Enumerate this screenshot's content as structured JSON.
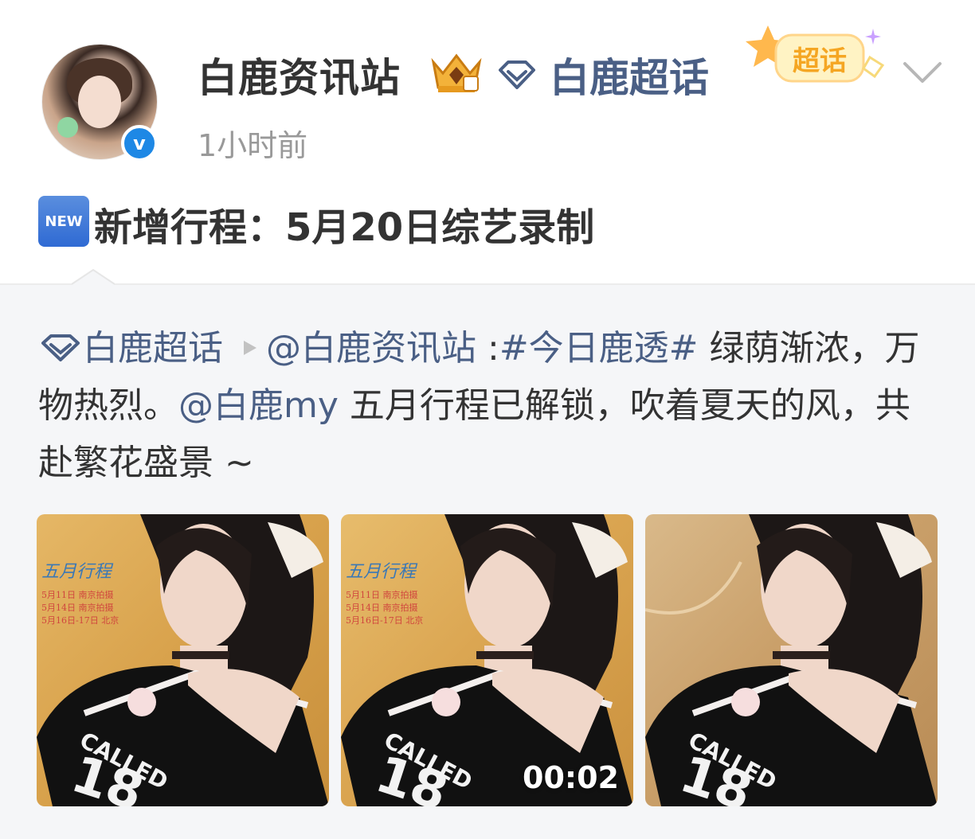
{
  "header": {
    "username": "白鹿资讯站",
    "topic_label": "白鹿超话",
    "supertopic_badge_label": "超话",
    "timestamp": "1小时前"
  },
  "post": {
    "new_badge_label": "NEW",
    "title": "新增行程：5月20日综艺录制"
  },
  "repost": {
    "topic_label": "白鹿超话",
    "mention_author": "@白鹿资讯站",
    "separator": " :",
    "hashtag": "#今日鹿透#",
    "text_part1": " 绿荫渐浓，万物热烈。",
    "mention_star": "@白鹿my",
    "text_part2": " 五月行程已解锁，吹着夏天的风，共赴繁花盛景 ~",
    "images": [
      {
        "caption_main": "五月行程",
        "caption_lines": "5月11日 南京拍摄\n5月14日 南京拍摄\n5月16日-17日 北京"
      },
      {
        "caption_main": "五月行程",
        "caption_lines": "5月11日 南京拍摄\n5月14日 南京拍摄\n5月16日-17日 北京",
        "video_duration": "00:02"
      },
      {
        "caption_main": "",
        "caption_lines": ""
      }
    ],
    "shirt_text": "CALLED"
  },
  "colors": {
    "link": "#4a5f85",
    "text": "#333333",
    "timestamp": "#999999",
    "verify": "#1e88e5",
    "repost_bg": "#f5f6f8"
  }
}
